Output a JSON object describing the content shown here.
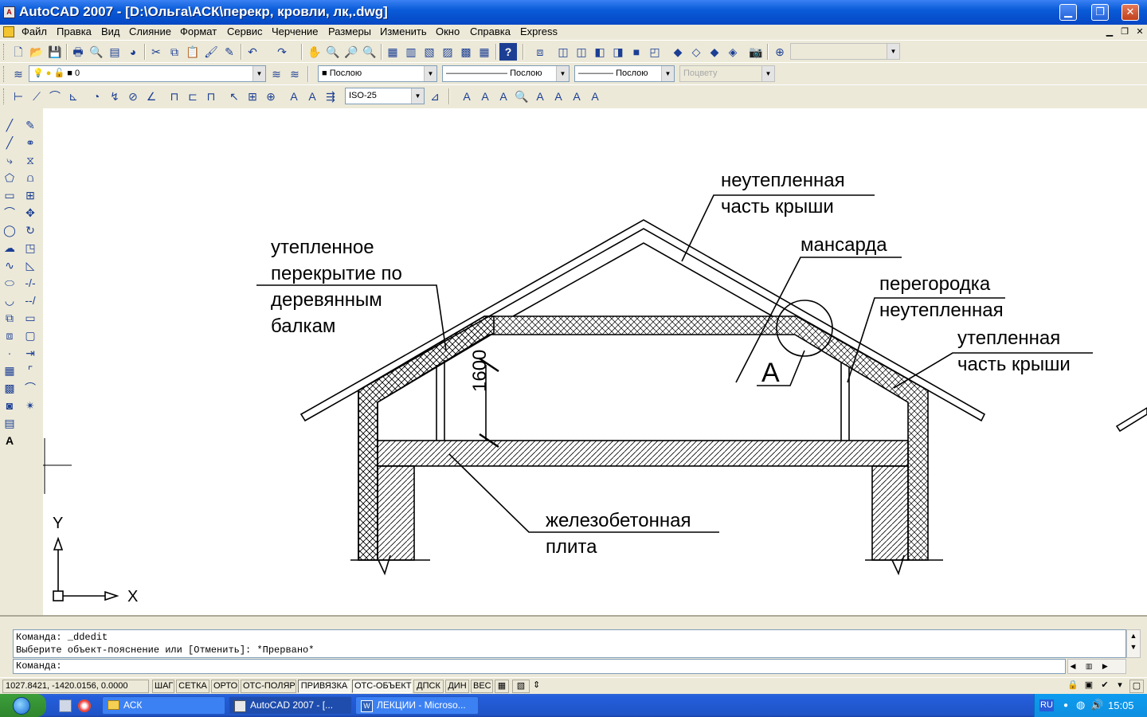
{
  "window": {
    "title": "AutoCAD 2007 - [D:\\Ольга\\АСК\\перекр, кровли, лк,.dwg]",
    "min_label": "▁",
    "max_label": "❐",
    "close_label": "✕"
  },
  "menu": {
    "items": [
      "Файл",
      "Правка",
      "Вид",
      "Слияние",
      "Формат",
      "Сервис",
      "Черчение",
      "Размеры",
      "Изменить",
      "Окно",
      "Справка",
      "Express"
    ]
  },
  "properties": {
    "layer_value": "0",
    "color_value": "Послою",
    "linetype_value": "Послою",
    "lineweight_value": "Послою",
    "plotstyle_value": "Поцвету"
  },
  "dimstyle": {
    "value": "ISO-25"
  },
  "drawing": {
    "label_unheated_roof": [
      "неутепленная",
      "часть крыши"
    ],
    "label_attic": "мансарда",
    "label_partition": [
      "перегородка",
      "неутепленная"
    ],
    "label_heated_roof": [
      "утепленная",
      "часть крыши"
    ],
    "label_insulated_floor": [
      "утепленное",
      "перекрытие по",
      "деревянным",
      "балкам"
    ],
    "label_slab": [
      "железобетонная",
      "плита"
    ],
    "callout_letter": "А",
    "dimension_value": "1600",
    "ucs_x": "X",
    "ucs_y": "Y"
  },
  "command": {
    "history": [
      "Команда:  _ddedit",
      "Выберите объект-пояснение или [Отменить]: *Прервано*"
    ],
    "prompt": "Команда:"
  },
  "status": {
    "coords": "1027.8421, -1420.0156, 0.0000",
    "toggles": [
      {
        "label": "ШАГ",
        "on": false
      },
      {
        "label": "СЕТКА",
        "on": false
      },
      {
        "label": "ОРТО",
        "on": false
      },
      {
        "label": "ОТС-ПОЛЯР",
        "on": false
      },
      {
        "label": "ПРИВЯЗКА",
        "on": true
      },
      {
        "label": "ОТС-ОБЪЕКТ",
        "on": true
      },
      {
        "label": "ДПСК",
        "on": false
      },
      {
        "label": "ДИН",
        "on": false
      },
      {
        "label": "ВЕС",
        "on": false
      }
    ]
  },
  "taskbar": {
    "tasks": [
      {
        "label": "АСК",
        "active": false
      },
      {
        "label": "AutoCAD 2007 - [...",
        "active": true
      },
      {
        "label": "ЛЕКЦИИ - Microso...",
        "active": false
      }
    ],
    "lang": "RU",
    "clock": "15:05"
  }
}
